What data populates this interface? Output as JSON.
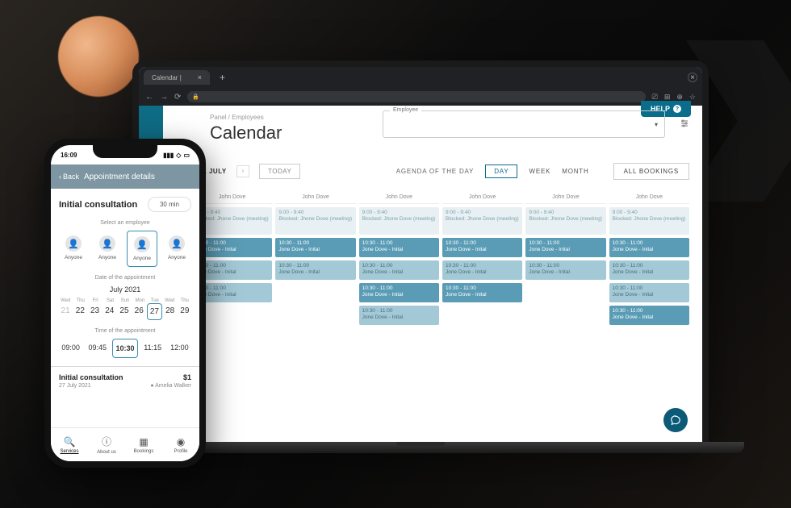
{
  "browser": {
    "tab_title": "Calendar |",
    "close": "×",
    "new_tab": "+"
  },
  "desktop": {
    "breadcrumb": "Panel / Employees",
    "title": "Calendar",
    "employee_label": "Employee",
    "help": "HELP",
    "toolbar": {
      "date": "21 JULY",
      "today": "TODAY",
      "agenda": "AGENDA OF THE DAY",
      "day": "DAY",
      "week": "WEEK",
      "month": "MONTH",
      "all_bookings": "ALL BOOKINGS"
    },
    "columns": [
      "John Dove",
      "John Dove",
      "John Dove",
      "John Dove",
      "John Dove",
      "John Dove"
    ],
    "blocked": {
      "time": "9:00 - 9:40",
      "text": "Blocked: Jhone Dove (meeting)"
    },
    "booking": {
      "time": "10:30 - 11:00",
      "text": "Jone Dove - Inital"
    },
    "col_layout": [
      [
        "blocked",
        "dark",
        "light",
        "light"
      ],
      [
        "blocked",
        "dark",
        "light"
      ],
      [
        "blocked",
        "dark",
        "light",
        "dark",
        "light"
      ],
      [
        "blocked",
        "dark",
        "light",
        "dark"
      ],
      [
        "blocked",
        "dark",
        "light"
      ],
      [
        "blocked",
        "dark",
        "light",
        "light",
        "dark"
      ]
    ]
  },
  "phone": {
    "status_time": "16:09",
    "back": "Back",
    "header": "Appointment details",
    "service": "Initial consultation",
    "duration": "30 min",
    "select_emp": "Select an employee",
    "anyone": "Anyone",
    "date_label": "Date of the appointment",
    "month": "July 2021",
    "dows": [
      "Wed",
      "Thu",
      "Fri",
      "Sat",
      "Sun",
      "Mon",
      "Tue",
      "Wed",
      "Thu"
    ],
    "dates": [
      "21",
      "22",
      "23",
      "24",
      "25",
      "26",
      "27",
      "28",
      "29"
    ],
    "selected_date_index": 6,
    "time_label": "Time of the appointment",
    "times": [
      "09:00",
      "09:45",
      "10:30",
      "11:15",
      "12:00"
    ],
    "selected_time_index": 2,
    "summary_title": "Initial consultation",
    "summary_price": "$1",
    "summary_date": "27 July 2021",
    "summary_emp": "Amelia Walker",
    "tabs": [
      {
        "label": "Services"
      },
      {
        "label": "About us"
      },
      {
        "label": "Bookings"
      },
      {
        "label": "Profile"
      }
    ]
  }
}
